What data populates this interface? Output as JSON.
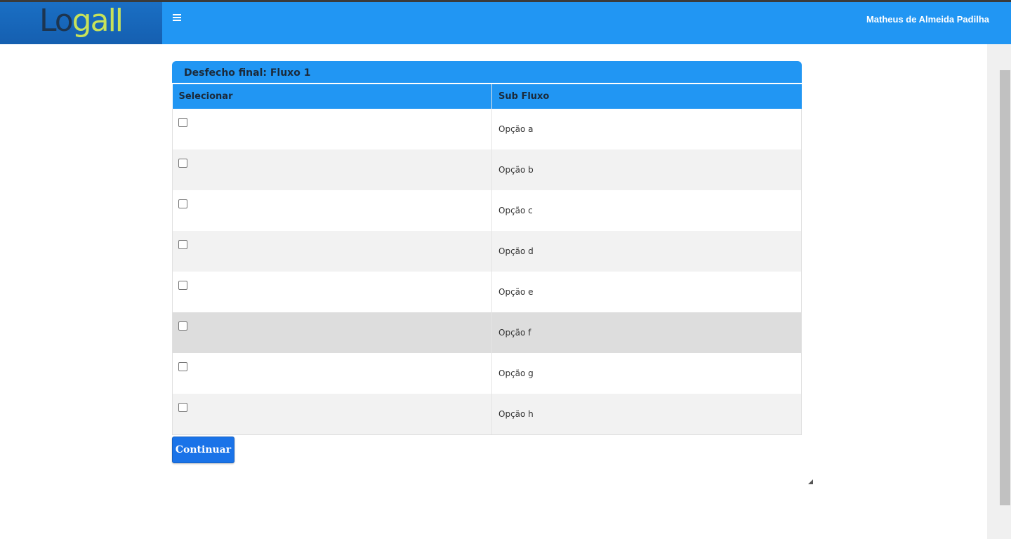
{
  "header": {
    "logo": {
      "part1": "Lo",
      "part2": "gall"
    },
    "menu_icon": "hamburger-menu-icon",
    "user_name": "Matheus de Almeida Padilha"
  },
  "panel": {
    "title": "Desfecho final: Fluxo 1",
    "columns": [
      "Selecionar",
      "Sub Fluxo"
    ],
    "rows": [
      {
        "label": "Opção a",
        "checked": false
      },
      {
        "label": "Opção b",
        "checked": false
      },
      {
        "label": "Opção c",
        "checked": false
      },
      {
        "label": "Opção d",
        "checked": false
      },
      {
        "label": "Opção e",
        "checked": false
      },
      {
        "label": "Opção f",
        "checked": false,
        "highlighted": true
      },
      {
        "label": "Opção g",
        "checked": false
      },
      {
        "label": "Opção h",
        "checked": false
      }
    ]
  },
  "actions": {
    "continue_label": "Continuar"
  },
  "colors": {
    "primary": "#2196f3",
    "button": "#1a73e8",
    "logo_lime": "#c8e25a"
  }
}
